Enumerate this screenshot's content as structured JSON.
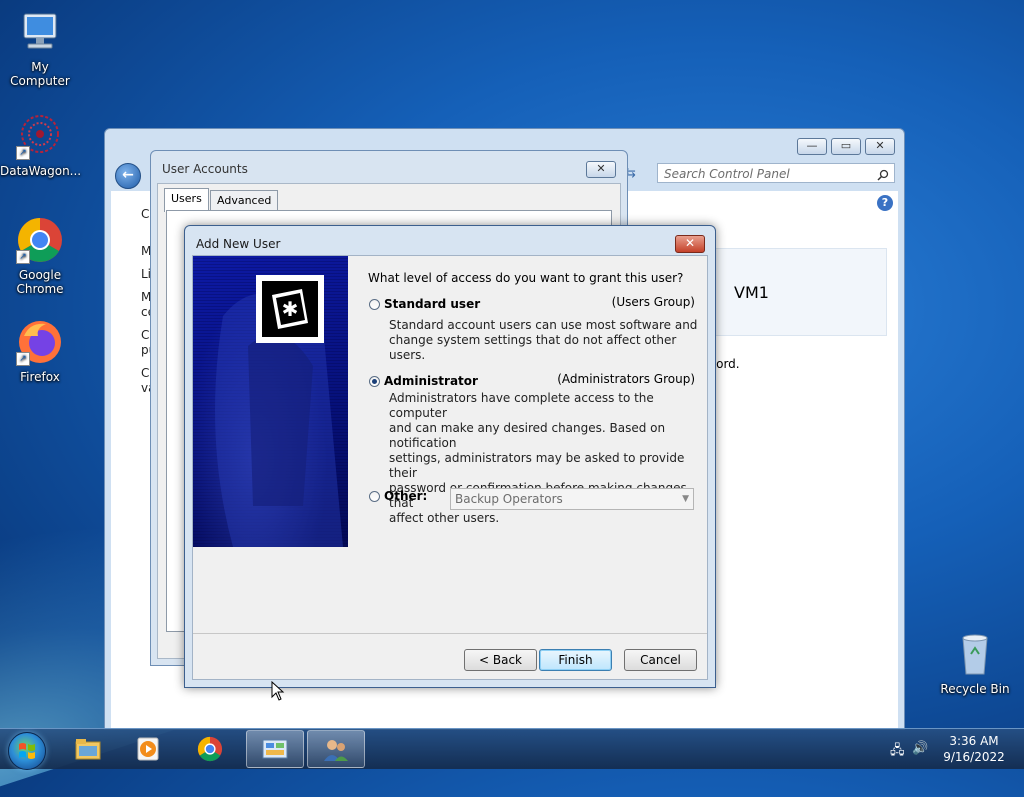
{
  "desktop": {
    "icons": [
      {
        "label": "My Computer"
      },
      {
        "label": "DataWagon..."
      },
      {
        "label": "Google Chrome"
      },
      {
        "label": "Firefox"
      },
      {
        "label": "Recycle Bin"
      }
    ]
  },
  "control_panel": {
    "search_placeholder": "Search Control Panel",
    "vm_name": "VM1",
    "partial_text": "vord.",
    "left_letters": [
      "C",
      "M",
      "Li",
      "M",
      "ce",
      "C",
      "pu",
      "C",
      "va"
    ]
  },
  "user_accounts": {
    "title": "User Accounts",
    "tabs": [
      {
        "label": "Users"
      },
      {
        "label": "Advanced"
      }
    ],
    "partial_letter": "U"
  },
  "add_new_user": {
    "title": "Add New User",
    "question": "What level of access do you want to grant this user?",
    "options": [
      {
        "label": "Standard user",
        "group": "(Users Group)",
        "description_lines": [
          "Standard account users can use most software and",
          "change system settings that do not affect other users."
        ],
        "selected": false
      },
      {
        "label": "Administrator",
        "group": "(Administrators Group)",
        "description_lines": [
          "Administrators have complete access to the computer",
          "and can make any desired changes. Based on notification",
          "settings, administrators may be asked to provide their",
          "password or confirmation before making changes that",
          "affect other users."
        ],
        "selected": true
      },
      {
        "label": "Other:",
        "selected": false
      }
    ],
    "other_select_value": "Backup Operators",
    "buttons": {
      "back": "< Back",
      "finish": "Finish",
      "cancel": "Cancel"
    }
  },
  "taskbar": {
    "time": "3:36 AM",
    "date": "9/16/2022"
  }
}
